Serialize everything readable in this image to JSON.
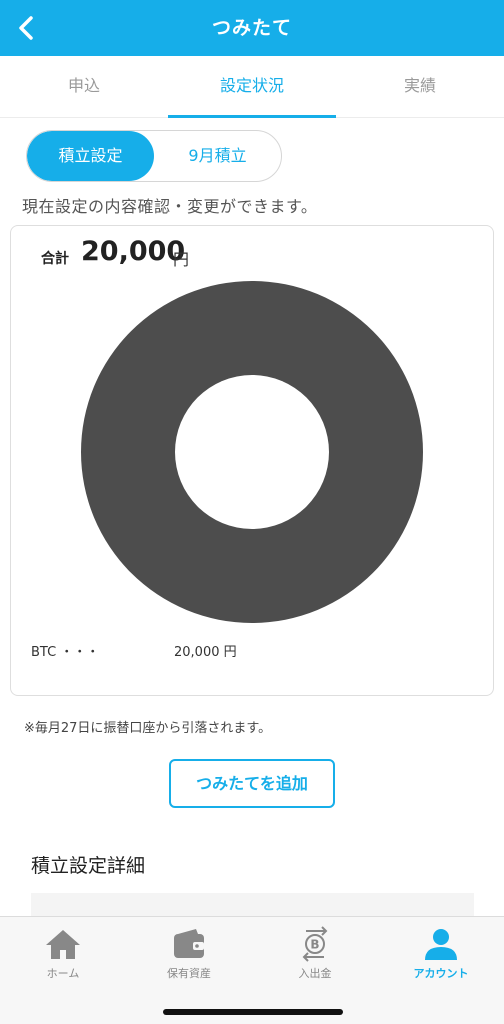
{
  "header": {
    "title": "つみたて"
  },
  "tabs": [
    {
      "label": "申込",
      "active": false
    },
    {
      "label": "設定状況",
      "active": true
    },
    {
      "label": "実績",
      "active": false
    }
  ],
  "segment": [
    {
      "label": "積立設定",
      "active": true
    },
    {
      "label": "9月積立",
      "active": false
    }
  ],
  "description": "現在設定の内容確認・変更ができます。",
  "summary": {
    "total_label": "合計",
    "total_value": "20,000",
    "total_unit": "円"
  },
  "chart_data": {
    "type": "pie",
    "categories": [
      "BTC"
    ],
    "values": [
      20000
    ],
    "colors": [
      "#4d4d4d"
    ]
  },
  "legend": [
    {
      "name": "BTC ・・・",
      "amount": "20,000 円"
    }
  ],
  "note": "※毎月27日に振替口座から引落されます。",
  "add_button": "つみたてを追加",
  "details_title": "積立設定詳細",
  "bottom_nav": [
    {
      "label": "ホーム",
      "icon": "home-icon",
      "active": false
    },
    {
      "label": "保有資産",
      "icon": "wallet-icon",
      "active": false
    },
    {
      "label": "入出金",
      "icon": "bitcoin-transfer-icon",
      "active": false
    },
    {
      "label": "アカウント",
      "icon": "user-icon",
      "active": true
    }
  ],
  "colors": {
    "accent": "#16aee9",
    "donut": "#4d4d4d",
    "inactive": "#888888"
  }
}
